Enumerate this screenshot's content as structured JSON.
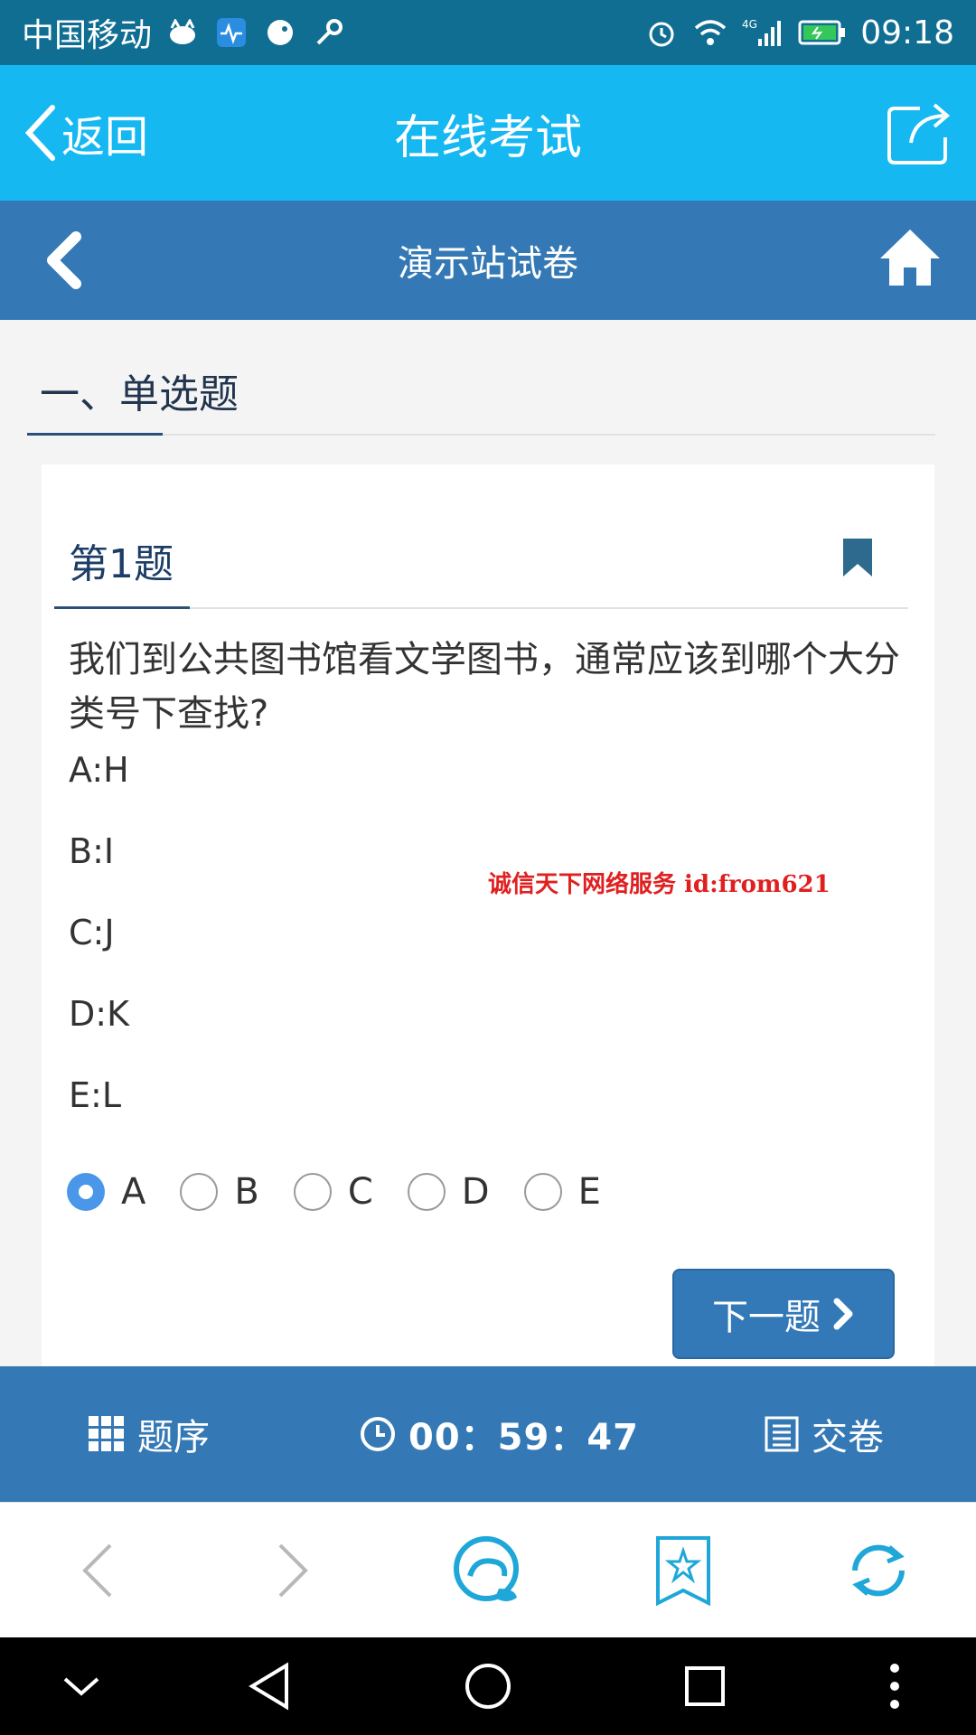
{
  "status_bar": {
    "carrier": "中国移动",
    "network": "4G",
    "time": "09:18"
  },
  "app_header": {
    "back_label": "返回",
    "title": "在线考试",
    "share_icon": "share-icon",
    "background_color": "#16b8f2"
  },
  "sub_header": {
    "title": "演示站试卷",
    "home_icon": "home-icon",
    "background_color": "#3479b5"
  },
  "section": {
    "title": "一、单选题"
  },
  "question": {
    "number_label": "第1题",
    "text": "我们到公共图书馆看文学图书，通常应该到哪个大分类号下查找?",
    "options": [
      {
        "text": "A:H"
      },
      {
        "text": "B:I"
      },
      {
        "text": "C:J"
      },
      {
        "text": "D:K"
      },
      {
        "text": "E:L"
      }
    ],
    "answers": [
      {
        "label": "A",
        "checked": true
      },
      {
        "label": "B",
        "checked": false
      },
      {
        "label": "C",
        "checked": false
      },
      {
        "label": "D",
        "checked": false
      },
      {
        "label": "E",
        "checked": false
      }
    ],
    "next_label": "下一题"
  },
  "watermark": "诚信天下网络服务 id:from621",
  "exam_bar": {
    "order_label": "题序",
    "timer": "00：59：47",
    "submit_label": "交卷"
  },
  "browser_bar": {
    "buttons": [
      "back-arrow-icon",
      "forward-arrow-icon",
      "search-cloud-icon",
      "bookmark-star-icon",
      "refresh-icon"
    ]
  },
  "colors": {
    "accent": "#3479b5",
    "selected_radio": "#4a97e9",
    "watermark": "#e02020"
  }
}
